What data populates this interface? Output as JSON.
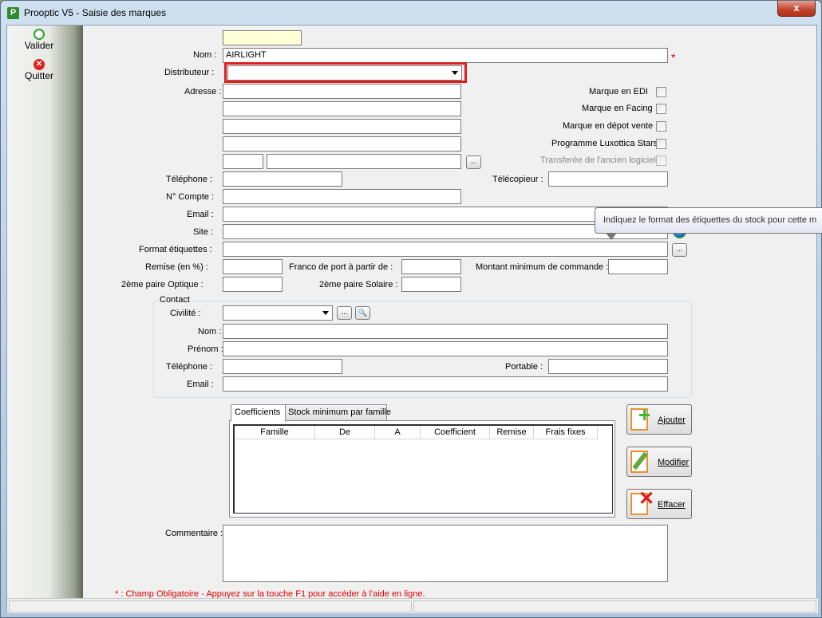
{
  "window": {
    "title": "Prooptic V5 - Saisie des marques",
    "close_label": "x",
    "app_icon": "P"
  },
  "sidebar": {
    "valider": {
      "label": "Valider",
      "icon": "check-circle-icon"
    },
    "quitter": {
      "label": "Quitter",
      "icon": "red-x-icon"
    }
  },
  "form": {
    "nom_label": "Nom :",
    "nom_value": "AIRLIGHT",
    "required_mark": "*",
    "distributeur_label": "Distributeur :",
    "distributeur_value": "",
    "adresse_label": "Adresse :",
    "telephone_label": "Téléphone :",
    "telecopieur_label": "Télécopieur :",
    "compte_label": "N° Compte :",
    "email_label": "Email :",
    "site_label": "Site :",
    "format_label": "Format étiquettes :",
    "remise_label": "Remise (en %) :",
    "franco_label": "Franco de port à partir de  :",
    "montant_label": "Montant minimum de commande :",
    "paire_optique_label": "2ème paire Optique :",
    "paire_solaire_label": "2ème paire Solaire :",
    "browse_label": "...",
    "checkboxes": [
      {
        "label": "Marque en EDI",
        "checked": false,
        "enabled": true
      },
      {
        "label": "Marque en Facing",
        "checked": false,
        "enabled": true
      },
      {
        "label": "Marque en dépot vente",
        "checked": false,
        "enabled": true
      },
      {
        "label": "Programme Luxottica Stars",
        "checked": false,
        "enabled": true
      },
      {
        "label": "Transferée de l'ancien logiciel",
        "checked": false,
        "enabled": false
      }
    ]
  },
  "tooltip": {
    "text": "Indiquez le format des étiquettes du stock pour cette m"
  },
  "contact": {
    "legend": "Contact",
    "civilite_label": "Civilité :",
    "nom_label": "Nom :",
    "prenom_label": "Prénom :",
    "telephone_label": "Téléphone :",
    "portable_label": "Portable :",
    "email_label": "Email :"
  },
  "tabs": [
    {
      "label": "Coefficients",
      "active": true
    },
    {
      "label": "Stock minimum par famille",
      "active": false
    }
  ],
  "grid": {
    "columns": [
      "Famille",
      "De",
      "A",
      "Coefficient",
      "Remise",
      "Frais fixes"
    ]
  },
  "actions": {
    "ajouter": "Ajouter",
    "modifier": "Modifier",
    "effacer": "Effacer"
  },
  "commentaire_label": "Commentaire :",
  "footer_note": "* : Champ Obligatoire - Appuyez sur la touche F1 pour accéder à l'aide en ligne."
}
